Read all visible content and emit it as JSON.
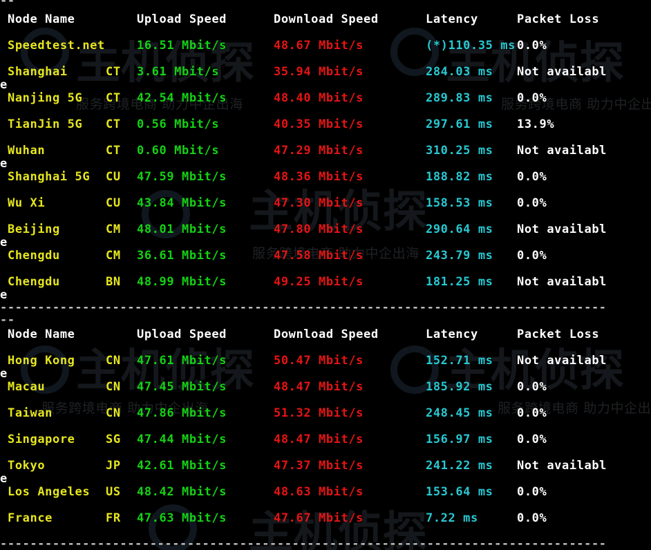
{
  "colors": {
    "white": "#ffffff",
    "yellow": "#e6e61e",
    "green": "#14d214",
    "red": "#e61414",
    "cyan": "#28c8d2",
    "gray": "#c0c0c0"
  },
  "watermark": {
    "brand_text": "主机侦探",
    "slogan_text": "服务跨境电商 助力中企出海",
    "logo_icon": "detective-magnifier-icon"
  },
  "top_dashes": "--",
  "section1": {
    "header": {
      "node_name": "Node Name",
      "upload_speed": "Upload Speed",
      "download_speed": "Download Speed",
      "latency": "Latency",
      "packet_loss": "Packet Loss"
    },
    "rows": [
      {
        "node": "Speedtest.net",
        "isp": "",
        "upload": "16.51 Mbit/s",
        "download": "48.67 Mbit/s",
        "latency": "(*)110.35 ms",
        "loss": "0.0%",
        "wrap": ""
      },
      {
        "node": "Shanghai",
        "isp": "CT",
        "upload": "3.61 Mbit/s",
        "download": "35.94 Mbit/s",
        "latency": "284.03 ms",
        "loss": "Not availabl",
        "wrap": "e"
      },
      {
        "node": "Nanjing 5G",
        "isp": "CT",
        "upload": "42.54 Mbit/s",
        "download": "48.40 Mbit/s",
        "latency": "289.83 ms",
        "loss": "0.0%",
        "wrap": ""
      },
      {
        "node": "TianJin 5G",
        "isp": "CT",
        "upload": "0.56 Mbit/s",
        "download": "40.35 Mbit/s",
        "latency": "297.61 ms",
        "loss": "13.9%",
        "wrap": ""
      },
      {
        "node": "Wuhan",
        "isp": "CT",
        "upload": "0.60 Mbit/s",
        "download": "47.29 Mbit/s",
        "latency": "310.25 ms",
        "loss": "Not availabl",
        "wrap": "e"
      },
      {
        "node": "Shanghai 5G",
        "isp": "CU",
        "upload": "47.59 Mbit/s",
        "download": "48.36 Mbit/s",
        "latency": "188.82 ms",
        "loss": "0.0%",
        "wrap": ""
      },
      {
        "node": "Wu Xi",
        "isp": "CU",
        "upload": "43.84 Mbit/s",
        "download": "47.30 Mbit/s",
        "latency": "158.53 ms",
        "loss": "0.0%",
        "wrap": ""
      },
      {
        "node": "Beijing",
        "isp": "CM",
        "upload": "48.01 Mbit/s",
        "download": "47.80 Mbit/s",
        "latency": "290.64 ms",
        "loss": "Not availabl",
        "wrap": "e"
      },
      {
        "node": "Chengdu",
        "isp": "CM",
        "upload": "36.61 Mbit/s",
        "download": "47.58 Mbit/s",
        "latency": "243.79 ms",
        "loss": "0.0%",
        "wrap": ""
      },
      {
        "node": "Chengdu",
        "isp": "BN",
        "upload": "48.99 Mbit/s",
        "download": "49.25 Mbit/s",
        "latency": "181.25 ms",
        "loss": "Not availabl",
        "wrap": "e"
      }
    ]
  },
  "separator": "----------------------------------------------------------------------------------------------------------------------------------------------------------------",
  "section2": {
    "header": {
      "node_name": "Node Name",
      "upload_speed": "Upload Speed",
      "download_speed": "Download Speed",
      "latency": "Latency",
      "packet_loss": "Packet Loss"
    },
    "rows": [
      {
        "node": "Hong Kong",
        "isp": "CN",
        "upload": "47.61 Mbit/s",
        "download": "50.47 Mbit/s",
        "latency": "152.71 ms",
        "loss": "Not availabl",
        "wrap": "e"
      },
      {
        "node": "Macau",
        "isp": "CN",
        "upload": "47.45 Mbit/s",
        "download": "48.47 Mbit/s",
        "latency": "185.92 ms",
        "loss": "0.0%",
        "wrap": ""
      },
      {
        "node": "Taiwan",
        "isp": "CN",
        "upload": "47.86 Mbit/s",
        "download": "51.32 Mbit/s",
        "latency": "248.45 ms",
        "loss": "0.0%",
        "wrap": ""
      },
      {
        "node": "Singapore",
        "isp": "SG",
        "upload": "47.44 Mbit/s",
        "download": "48.47 Mbit/s",
        "latency": "156.97 ms",
        "loss": "0.0%",
        "wrap": ""
      },
      {
        "node": "Tokyo",
        "isp": "JP",
        "upload": "42.61 Mbit/s",
        "download": "47.37 Mbit/s",
        "latency": "241.22 ms",
        "loss": "Not availabl",
        "wrap": "e"
      },
      {
        "node": "Los Angeles",
        "isp": "US",
        "upload": "48.42 Mbit/s",
        "download": "48.63 Mbit/s",
        "latency": "153.64 ms",
        "loss": "0.0%",
        "wrap": ""
      },
      {
        "node": "France",
        "isp": "FR",
        "upload": "47.63 Mbit/s",
        "download": "47.67 Mbit/s",
        "latency": "7.22 ms",
        "loss": "0.0%",
        "wrap": ""
      }
    ]
  }
}
